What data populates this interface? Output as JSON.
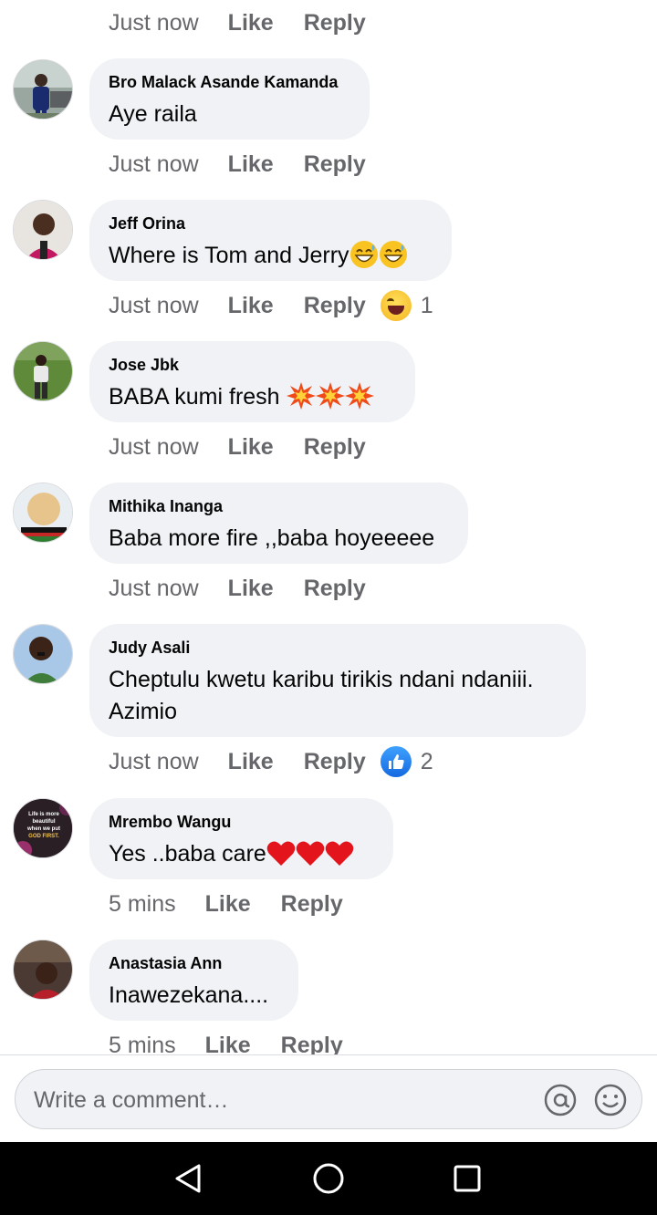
{
  "comments": [
    {
      "time": "Just now",
      "like": "Like",
      "reply": "Reply"
    },
    {
      "name": "Bro Malack Asande Kamanda",
      "text": "Aye raila",
      "time": "Just now",
      "like": "Like",
      "reply": "Reply"
    },
    {
      "name": "Jeff Orina",
      "text": "Where is Tom and Jerry",
      "time": "Just now",
      "like": "Like",
      "reply": "Reply",
      "reaction_icon": "laughing-emoji",
      "reaction_count": "1"
    },
    {
      "name": "Jose Jbk",
      "text": "BABA kumi fresh",
      "time": "Just now",
      "like": "Like",
      "reply": "Reply"
    },
    {
      "name": "Mithika Inanga",
      "text": "Baba more fire ,,baba hoyeeeee",
      "time": "Just now",
      "like": "Like",
      "reply": "Reply"
    },
    {
      "name": "Judy Asali",
      "text": "Cheptulu kwetu karibu tirikis ndani ndaniii.",
      "text2": "Azimio",
      "time": "Just now",
      "like": "Like",
      "reply": "Reply",
      "reaction_icon": "thumbs-up-emoji",
      "reaction_count": "2"
    },
    {
      "name": "Mrembo Wangu",
      "text": "Yes ..baba care",
      "avatar_text": [
        "Life is more",
        "beautiful",
        "when we put",
        "GOD FIRST."
      ],
      "time": "5 mins",
      "like": "Like",
      "reply": "Reply"
    },
    {
      "name": "Anastasia Ann",
      "text": "Inawezekana....",
      "time": "5 mins",
      "like": "Like",
      "reply": "Reply"
    }
  ],
  "composer": {
    "placeholder": "Write a comment…",
    "mention_icon": "at-sign-icon",
    "emoji_icon": "smiley-icon"
  },
  "nav": {
    "back_icon": "back-triangle-icon",
    "home_icon": "home-circle-icon",
    "recents_icon": "recents-square-icon"
  },
  "colors": {
    "bubble": "#f0f2f5",
    "meta": "#65676b",
    "like_blue": "#1877f2",
    "nav_bar": "#000000"
  }
}
